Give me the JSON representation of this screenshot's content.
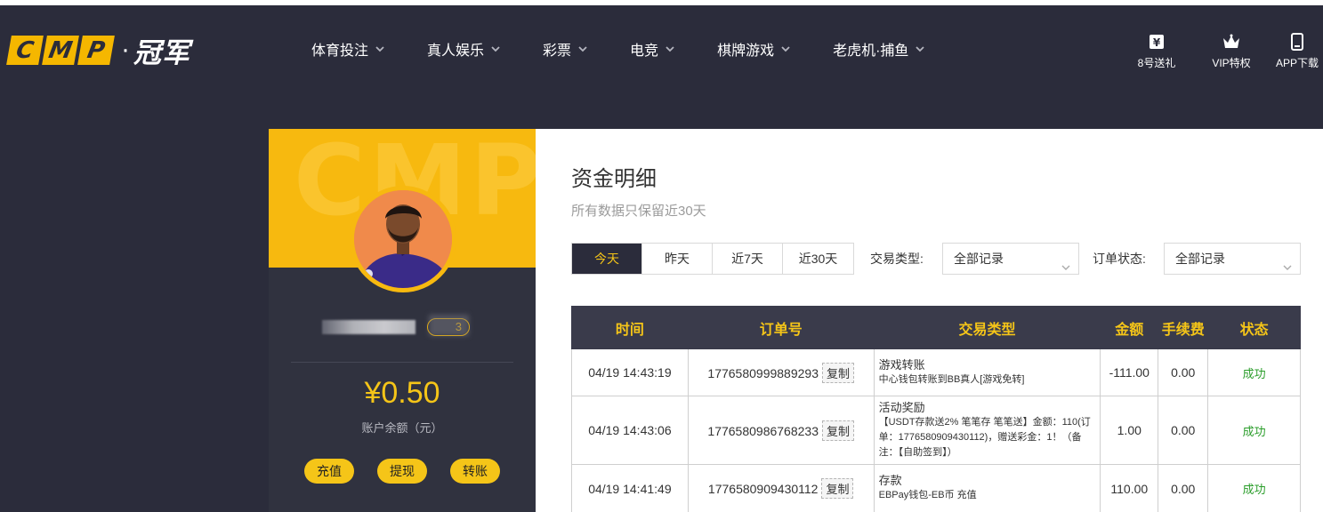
{
  "brand": {
    "letters": [
      "C",
      "M",
      "P"
    ],
    "suffix": "冠军"
  },
  "nav": [
    {
      "label": "体育投注"
    },
    {
      "label": "真人娱乐"
    },
    {
      "label": "彩票"
    },
    {
      "label": "电竞"
    },
    {
      "label": "棋牌游戏"
    },
    {
      "label": "老虎机·捕鱼"
    }
  ],
  "header_links": [
    {
      "label": "8号送礼",
      "icon": "yen-gift-icon"
    },
    {
      "label": "VIP特权",
      "icon": "crown-icon"
    },
    {
      "label": "APP下载",
      "icon": "mobile-icon"
    }
  ],
  "profile": {
    "banner_text": "CMP",
    "vip_level": "3",
    "balance": "¥0.50",
    "balance_label": "账户余额（元）",
    "actions": [
      "充值",
      "提现",
      "转账"
    ]
  },
  "main": {
    "title": "资金明细",
    "subtitle": "所有数据只保留近30天",
    "tabs": [
      "今天",
      "昨天",
      "近7天",
      "近30天"
    ],
    "active_tab": "今天",
    "filters": {
      "type_label": "交易类型:",
      "type_value": "全部记录",
      "status_label": "订单状态:",
      "status_value": "全部记录"
    },
    "copy_label": "复制",
    "table": {
      "headers": [
        "时间",
        "订单号",
        "交易类型",
        "金额",
        "手续费",
        "状态"
      ],
      "rows": [
        {
          "time": "04/19 14:43:19",
          "order": "1776580999889293",
          "type_title": "游戏转账",
          "type_detail": "中心钱包转账到BB真人[游戏免转]",
          "amount": "-111.00",
          "fee": "0.00",
          "status": "成功"
        },
        {
          "time": "04/19 14:43:06",
          "order": "1776580986768233",
          "type_title": "活动奖励",
          "type_detail": "【USDT存款送2% 笔笔存 笔笔送】金额：110(订单：1776580909430112)，赠送彩金：1！（备注：【自助签到】）",
          "amount": "1.00",
          "fee": "0.00",
          "status": "成功"
        },
        {
          "time": "04/19 14:41:49",
          "order": "1776580909430112",
          "type_title": "存款",
          "type_detail": "EBPay钱包-EB币 充值",
          "amount": "110.00",
          "fee": "0.00",
          "status": "成功"
        }
      ]
    }
  },
  "colors": {
    "header_bg": "#2b2c3b",
    "accent_yellow": "#f5c518",
    "success_green": "#2a9d2a",
    "table_header_bg": "#3a3b4b"
  }
}
